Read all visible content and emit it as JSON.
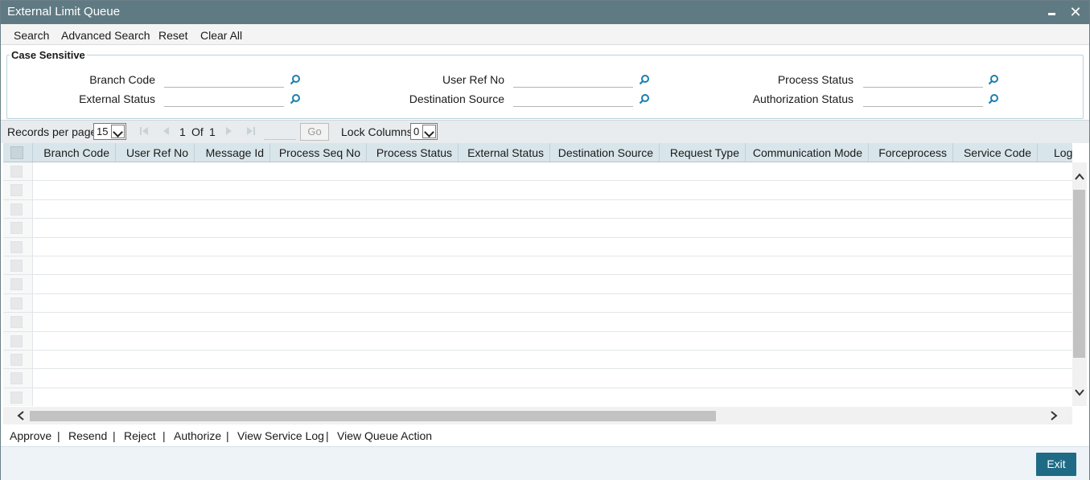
{
  "window": {
    "title": "External Limit Queue"
  },
  "toolbar": {
    "search": "Search",
    "advanced_search": "Advanced Search",
    "reset": "Reset",
    "clear_all": "Clear All"
  },
  "criteria": {
    "legend": "Case Sensitive",
    "branch_code": {
      "label": "Branch Code",
      "value": ""
    },
    "user_ref_no": {
      "label": "User Ref No",
      "value": ""
    },
    "process_status": {
      "label": "Process Status",
      "value": ""
    },
    "external_status": {
      "label": "External Status",
      "value": ""
    },
    "destination_source": {
      "label": "Destination Source",
      "value": ""
    },
    "authorization_status": {
      "label": "Authorization Status",
      "value": ""
    }
  },
  "pager": {
    "records_per_page_label": "Records per page",
    "records_per_page": "15",
    "current_page": "1",
    "of_label": "Of",
    "total_pages": "1",
    "go_label": "Go",
    "lock_columns_label": "Lock Columns",
    "lock_columns": "0"
  },
  "grid": {
    "columns": [
      "Branch Code",
      "User Ref No",
      "Message Id",
      "Process Seq No",
      "Process Status",
      "External Status",
      "Destination Source",
      "Request Type",
      "Communication Mode",
      "Forceprocess",
      "Service Code",
      "Log"
    ],
    "rows": 13
  },
  "actions": {
    "approve": "Approve",
    "resend": "Resend",
    "reject": "Reject",
    "authorize": "Authorize",
    "view_service_log": "View Service Log",
    "view_queue_action": "View Queue Action",
    "separator": "|"
  },
  "footer": {
    "exit": "Exit"
  },
  "colors": {
    "titlebar": "#5f7a83",
    "grid_header": "#d8e5ea",
    "exit_button": "#1f6b86",
    "lookup_icon": "#1a7fb0"
  }
}
